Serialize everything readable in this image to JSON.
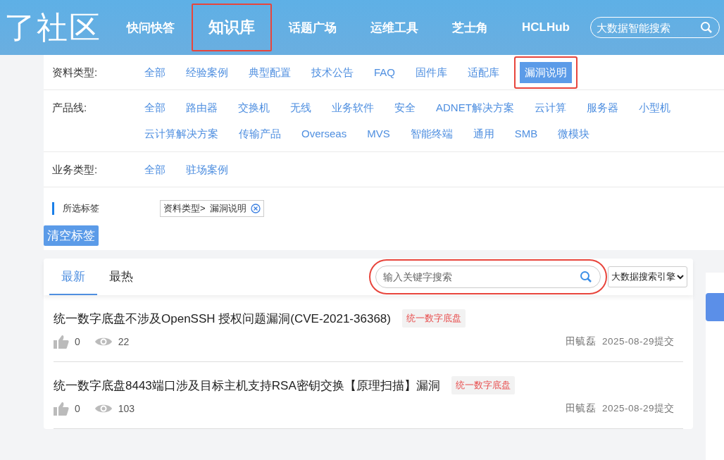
{
  "header": {
    "logo": "了社区",
    "nav": [
      {
        "label": "快问快答",
        "selected": false,
        "highlighted": false
      },
      {
        "label": "知识库",
        "selected": true,
        "highlighted": true
      },
      {
        "label": "话题广场",
        "selected": false,
        "highlighted": false
      },
      {
        "label": "运维工具",
        "selected": false,
        "highlighted": false
      },
      {
        "label": "芝士角",
        "selected": false,
        "highlighted": false
      },
      {
        "label": "HCLHub",
        "selected": false,
        "highlighted": false
      }
    ],
    "search": {
      "placeholder": "大数据智能搜索"
    }
  },
  "filters": [
    {
      "label": "资料类型:",
      "options": [
        {
          "label": "全部",
          "selected": false,
          "highlighted": false
        },
        {
          "label": "经验案例",
          "selected": false,
          "highlighted": false
        },
        {
          "label": "典型配置",
          "selected": false,
          "highlighted": false
        },
        {
          "label": "技术公告",
          "selected": false,
          "highlighted": false
        },
        {
          "label": "FAQ",
          "selected": false,
          "highlighted": false
        },
        {
          "label": "固件库",
          "selected": false,
          "highlighted": false
        },
        {
          "label": "适配库",
          "selected": false,
          "highlighted": false
        },
        {
          "label": "漏洞说明",
          "selected": true,
          "highlighted": true
        }
      ]
    },
    {
      "label": "产品线:",
      "options": [
        {
          "label": "全部",
          "selected": false,
          "highlighted": false
        },
        {
          "label": "路由器",
          "selected": false,
          "highlighted": false
        },
        {
          "label": "交换机",
          "selected": false,
          "highlighted": false
        },
        {
          "label": "无线",
          "selected": false,
          "highlighted": false
        },
        {
          "label": "业务软件",
          "selected": false,
          "highlighted": false
        },
        {
          "label": "安全",
          "selected": false,
          "highlighted": false
        },
        {
          "label": "ADNET解决方案",
          "selected": false,
          "highlighted": false
        },
        {
          "label": "云计算",
          "selected": false,
          "highlighted": false
        },
        {
          "label": "服务器",
          "selected": false,
          "highlighted": false
        },
        {
          "label": "小型机",
          "selected": false,
          "highlighted": false
        },
        {
          "label": "云计算解决方案",
          "selected": false,
          "highlighted": false
        },
        {
          "label": "传输产品",
          "selected": false,
          "highlighted": false
        },
        {
          "label": "Overseas",
          "selected": false,
          "highlighted": false
        },
        {
          "label": "MVS",
          "selected": false,
          "highlighted": false
        },
        {
          "label": "智能终端",
          "selected": false,
          "highlighted": false
        },
        {
          "label": "通用",
          "selected": false,
          "highlighted": false
        },
        {
          "label": "SMB",
          "selected": false,
          "highlighted": false
        },
        {
          "label": "微模块",
          "selected": false,
          "highlighted": false
        }
      ]
    },
    {
      "label": "业务类型:",
      "options": [
        {
          "label": "全部",
          "selected": false,
          "highlighted": false
        },
        {
          "label": "驻场案例",
          "selected": false,
          "highlighted": false
        }
      ]
    }
  ],
  "selected_tags": {
    "label": "所选标签",
    "tags": [
      {
        "category": "资料类型>",
        "value": "漏洞说明"
      }
    ],
    "clear_button": "清空标签"
  },
  "list": {
    "tabs": [
      {
        "label": "最新",
        "selected": true
      },
      {
        "label": "最热",
        "selected": false
      }
    ],
    "search": {
      "placeholder": "输入关键字搜索",
      "highlighted": true
    },
    "engine": "大数据搜索引擎",
    "articles": [
      {
        "title": "统一数字底盘不涉及OpenSSH 授权问题漏洞(CVE-2021-36368)",
        "tag": "统一数字底盘",
        "likes": "0",
        "views": "22",
        "author": "田毓磊",
        "date": "2025-08-29提交"
      },
      {
        "title": "统一数字底盘8443端口涉及目标主机支持RSA密钥交换【原理扫描】漏洞",
        "tag": "统一数字底盘",
        "likes": "0",
        "views": "103",
        "author": "田毓磊",
        "date": "2025-08-29提交"
      }
    ]
  }
}
